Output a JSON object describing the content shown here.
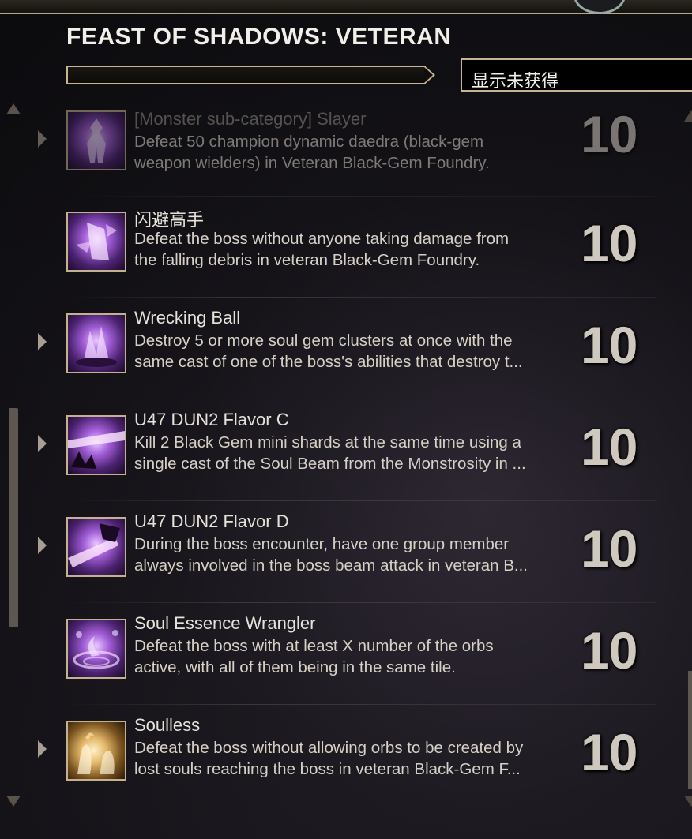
{
  "header": {
    "title": "FEAST OF SHADOWS:  VETERAN",
    "filter_label": "显示未获得"
  },
  "achievements": [
    {
      "name": "[Monster sub-category] Slayer",
      "desc1": "Defeat 50 champion dynamic daedra (black-gem",
      "desc2": "weapon wielders) in Veteran Black-Gem Foundry.",
      "points": "10",
      "expandable": true,
      "icon": "armored-figure-icon"
    },
    {
      "name": "闪避高手",
      "desc1": "Defeat the boss without anyone taking damage from",
      "desc2": "the falling debris in veteran Black-Gem Foundry.",
      "points": "10",
      "expandable": false,
      "icon": "crystal-shard-icon"
    },
    {
      "name": "Wrecking Ball",
      "desc1": "Destroy 5 or more soul gem clusters at once with the",
      "desc2": "same cast of one of the boss's abilities that destroy t...",
      "points": "10",
      "expandable": true,
      "icon": "crystal-cluster-icon"
    },
    {
      "name": "U47 DUN2 Flavor C",
      "desc1": "Kill 2 Black Gem mini shards at the same time using a",
      "desc2": "single cast of the Soul Beam from the Monstrosity in ...",
      "points": "10",
      "expandable": true,
      "icon": "soul-beam-icon"
    },
    {
      "name": "U47 DUN2 Flavor D",
      "desc1": "During the boss encounter, have one group member",
      "desc2": "always involved in the boss beam attack in veteran B...",
      "points": "10",
      "expandable": true,
      "icon": "beam-attack-icon"
    },
    {
      "name": "Soul Essence Wrangler",
      "desc1": "Defeat the boss with at least X number of the orbs",
      "desc2": "active, with all of them being in the same tile.",
      "points": "10",
      "expandable": false,
      "icon": "swirl-orbs-icon"
    },
    {
      "name": "Soulless",
      "desc1": "Defeat the boss without allowing orbs to be created by",
      "desc2": "lost souls reaching the boss in veteran Black-Gem F...",
      "points": "10",
      "expandable": true,
      "icon": "lost-souls-icon"
    }
  ]
}
